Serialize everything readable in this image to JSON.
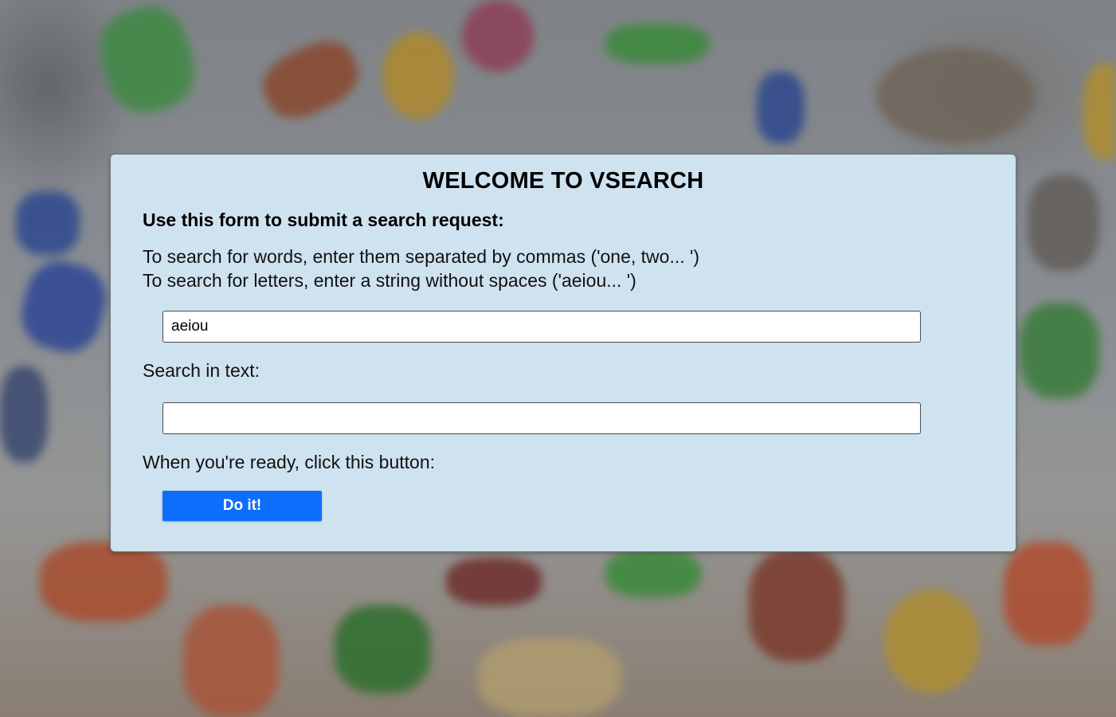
{
  "page": {
    "title": "WELCOME TO VSEARCH",
    "subtitle": "Use this form to submit a search request:",
    "instructions": [
      "To search for words, enter them separated by commas ('one, two... ')",
      "To search for letters, enter a string without spaces ('aeiou... ')"
    ]
  },
  "form": {
    "phrase_value": "aeiou",
    "search_label": "Search in text:",
    "text_value": "",
    "ready_label": "When you're ready, click this button:",
    "submit_label": "Do it!"
  },
  "colors": {
    "panel_bg": "#cfe2f0",
    "button_bg": "#0d6efd",
    "button_text": "#ffffff"
  },
  "background": {
    "description_icon": "blurred-alphabet-letters-background"
  }
}
